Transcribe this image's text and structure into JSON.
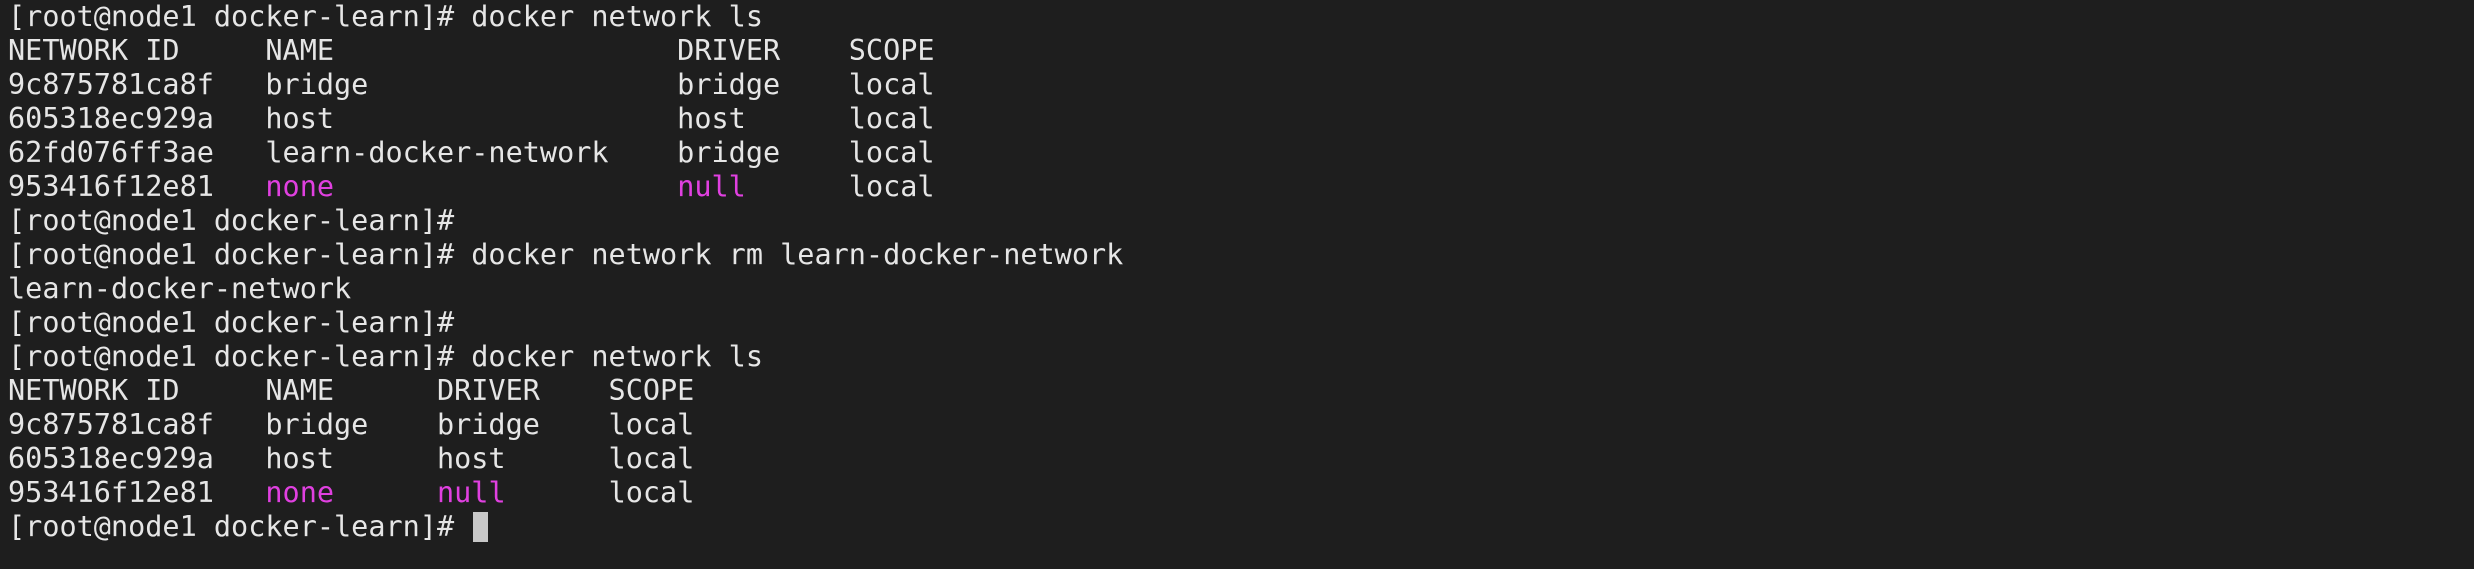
{
  "colors": {
    "background": "#1e1e1e",
    "text": "#e6e6e6",
    "highlight": "#e040e0",
    "cursor": "#c8c8c8"
  },
  "terminal": {
    "lines": [
      "[root@node1 docker-learn]# docker network ls",
      "NETWORK ID     NAME                    DRIVER    SCOPE",
      "9c875781ca8f   bridge                  bridge    local",
      "605318ec929a   host                    host      local",
      "62fd076ff3ae   learn-docker-network    bridge    local",
      {
        "pre": "953416f12e81   ",
        "name": "none",
        "mid": "                    ",
        "driver": "null",
        "post": "      local"
      },
      "[root@node1 docker-learn]#",
      "[root@node1 docker-learn]# docker network rm learn-docker-network",
      "learn-docker-network",
      "[root@node1 docker-learn]#",
      "[root@node1 docker-learn]# docker network ls",
      "NETWORK ID     NAME      DRIVER    SCOPE",
      "9c875781ca8f   bridge    bridge    local",
      "605318ec929a   host      host      local",
      {
        "pre": "953416f12e81   ",
        "name": "none",
        "mid": "      ",
        "driver": "null",
        "post": "      local"
      }
    ],
    "prompt": "[root@node1 docker-learn]# "
  }
}
